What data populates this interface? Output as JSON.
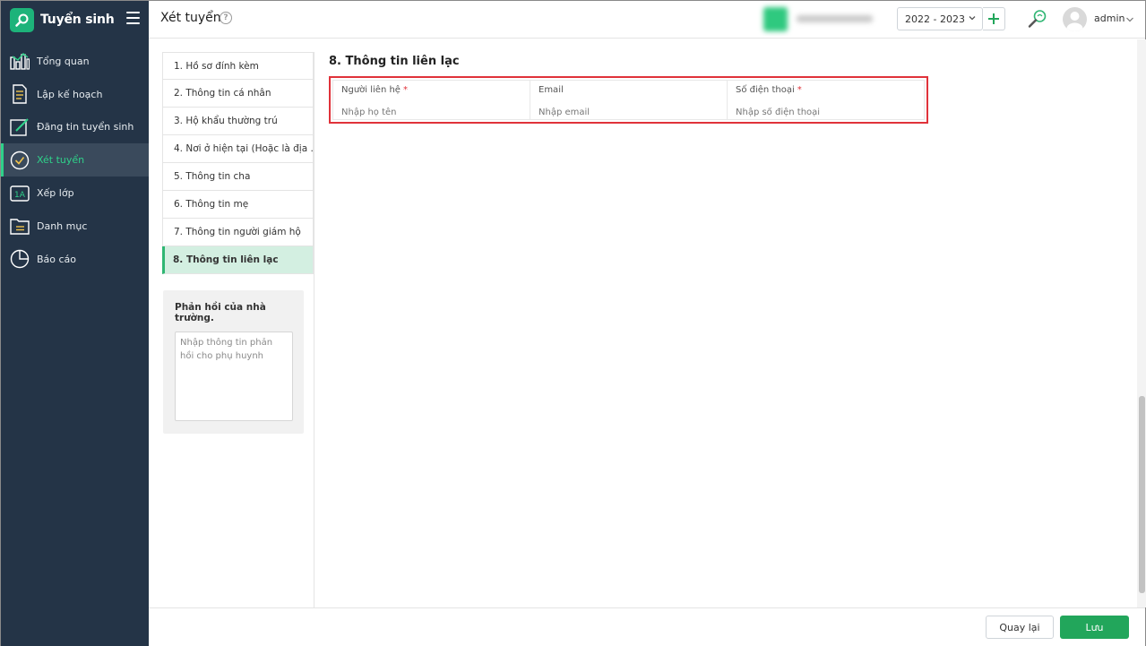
{
  "colors": {
    "sidebar_bg": "#243447",
    "accent": "#2fd18a",
    "primary_button": "#22a65b",
    "highlight_border": "#e0323a",
    "active_step_bg": "#d3efe1"
  },
  "brand": {
    "title": "Tuyển sinh",
    "logo_icon": "search-tool-icon"
  },
  "sidebar": {
    "items": [
      {
        "label": "Tổng quan",
        "icon": "bar-chart-icon"
      },
      {
        "label": "Lập kế hoạch",
        "icon": "document-list-icon"
      },
      {
        "label": "Đăng tin tuyển sinh",
        "icon": "edit-icon"
      },
      {
        "label": "Xét tuyển",
        "icon": "check-circle-icon",
        "active": true
      },
      {
        "label": "Xếp lớp",
        "icon": "class-1a-icon",
        "icon_text": "1A"
      },
      {
        "label": "Danh mục",
        "icon": "folder-icon"
      },
      {
        "label": "Báo cáo",
        "icon": "pie-chart-icon"
      }
    ]
  },
  "header": {
    "title": "Xét tuyển",
    "year": "2022 - 2023",
    "user": "admin"
  },
  "steps": [
    {
      "label": "1. Hồ sơ đính kèm"
    },
    {
      "label": "2. Thông tin cá nhân"
    },
    {
      "label": "3. Hộ khẩu thường trú"
    },
    {
      "label": "4. Nơi ở hiện tại (Hoặc là địa ..."
    },
    {
      "label": "5. Thông tin cha"
    },
    {
      "label": "6. Thông tin mẹ"
    },
    {
      "label": "7. Thông tin người giám hộ"
    },
    {
      "label": "8. Thông tin liên lạc",
      "active": true
    }
  ],
  "feedback": {
    "title": "Phản hồi của nhà trường.",
    "placeholder": "Nhập thông tin phản hồi cho phụ huynh"
  },
  "section": {
    "title": "8. Thông tin liên lạc",
    "fields": [
      {
        "label": "Người liên hệ",
        "required": "*",
        "placeholder": "Nhập họ tên"
      },
      {
        "label": "Email",
        "required": "",
        "placeholder": "Nhập email"
      },
      {
        "label": "Số điện thoại",
        "required": "*",
        "placeholder": "Nhập số điện thoại"
      }
    ]
  },
  "footer": {
    "back_label": "Quay lại",
    "save_label": "Lưu"
  }
}
